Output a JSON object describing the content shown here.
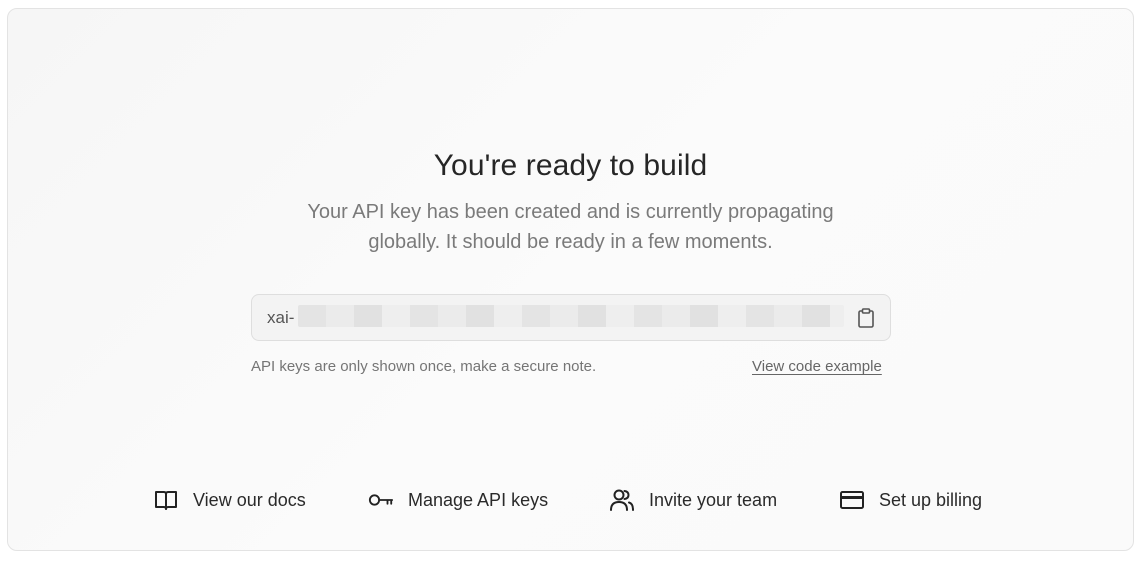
{
  "page": {
    "title": "You're ready to build",
    "subtitle_line1": "Your API key has been created and is currently propagating",
    "subtitle_line2": "globally. It should be ready in a few moments."
  },
  "api_key": {
    "prefix": "xai-",
    "note": "API keys are only shown once, make a secure note.",
    "code_link": "View code example"
  },
  "actions": [
    {
      "label": "View our docs",
      "icon": "book-icon"
    },
    {
      "label": "Manage API keys",
      "icon": "key-icon"
    },
    {
      "label": "Invite your team",
      "icon": "users-icon"
    },
    {
      "label": "Set up billing",
      "icon": "credit-card-icon"
    }
  ],
  "colors": {
    "card_background": "#f8f8f8",
    "title": "#262626",
    "muted_text": "#7a7a7a",
    "border": "#e3e3e3"
  }
}
